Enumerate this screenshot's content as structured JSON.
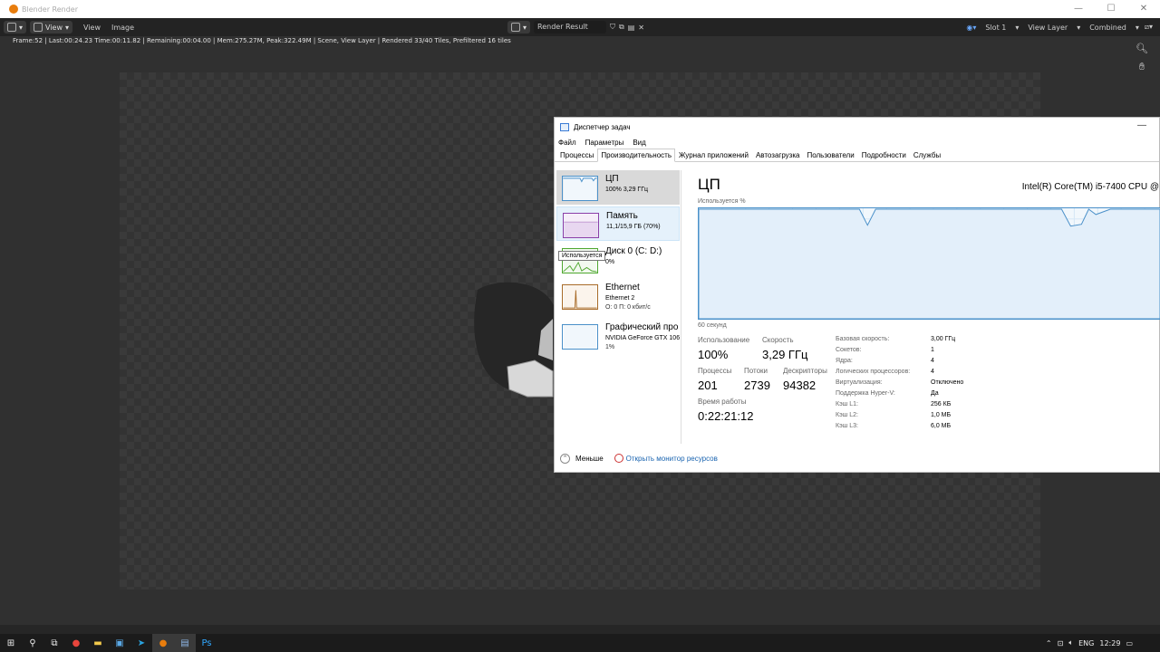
{
  "blender": {
    "window_title": "Blender Render",
    "header": {
      "menu_view": "View",
      "menu_view2": "View",
      "menu_image": "Image",
      "image_name": "Render Result",
      "slot": "Slot 1",
      "view_layer": "View Layer",
      "pass": "Combined"
    },
    "status": "Frame:52 | Last:00:24.23 Time:00:11.82 | Remaining:00:04.00 | Mem:275.27M, Peak:322.49M | Scene, View Layer | Rendered 33/40 Tiles, Prefiltered 16 tiles"
  },
  "taskmanager": {
    "title": "Диспетчер задач",
    "menu": [
      "Файл",
      "Параметры",
      "Вид"
    ],
    "tabs": [
      "Процессы",
      "Производительность",
      "Журнал приложений",
      "Автозагрузка",
      "Пользователи",
      "Подробности",
      "Службы"
    ],
    "active_tab": 1,
    "side": {
      "cpu": {
        "name": "ЦП",
        "sub": "100% 3,29 ГГц"
      },
      "memory": {
        "name": "Память",
        "sub": "11,1/15,9 ГБ (70%)"
      },
      "disk": {
        "name": "Диск 0 (C: D:)",
        "sub": "0%"
      },
      "ethernet": {
        "name": "Ethernet",
        "sub": "Ethernet 2",
        "sub2": "О: 0 П: 0 кбит/с"
      },
      "gpu": {
        "name": "Графический про",
        "sub": "NVIDIA GeForce GTX 106",
        "sub2": "1%"
      }
    },
    "tooltip": "Используется",
    "main": {
      "title": "ЦП",
      "cpu_model": "Intel(R) Core(TM) i5-7400 CPU @",
      "graph_label": "Используется %",
      "graph_time": "60 секунд",
      "stats": {
        "usage_label": "Использование",
        "usage": "100%",
        "speed_label": "Скорость",
        "speed": "3,29 ГГц",
        "proc_label": "Процессы",
        "proc": "201",
        "threads_label": "Потоки",
        "threads": "2739",
        "handles_label": "Дескрипторы",
        "handles": "94382",
        "uptime_label": "Время работы",
        "uptime": "0:22:21:12"
      },
      "info": [
        {
          "label": "Базовая скорость:",
          "value": "3,00 ГГц"
        },
        {
          "label": "Сокетов:",
          "value": "1"
        },
        {
          "label": "Ядра:",
          "value": "4"
        },
        {
          "label": "Логических процессоров:",
          "value": "4"
        },
        {
          "label": "Виртуализация:",
          "value": "Отключено"
        },
        {
          "label": "Поддержка Hyper-V:",
          "value": "Да"
        },
        {
          "label": "Кэш L1:",
          "value": "256 КБ"
        },
        {
          "label": "Кэш L2:",
          "value": "1,0 МБ"
        },
        {
          "label": "Кэш L3:",
          "value": "6,0 МБ"
        }
      ]
    },
    "footer": {
      "less": "Меньше",
      "monitor": "Открыть монитор ресурсов"
    }
  },
  "taskbar": {
    "lang": "ENG",
    "time": "12:29"
  },
  "colors": {
    "cpu": "#4a90c9",
    "memory": "#8b3fa8",
    "disk": "#4ea72e",
    "ethernet": "#a86b28",
    "gpu": "#4a90c9"
  }
}
